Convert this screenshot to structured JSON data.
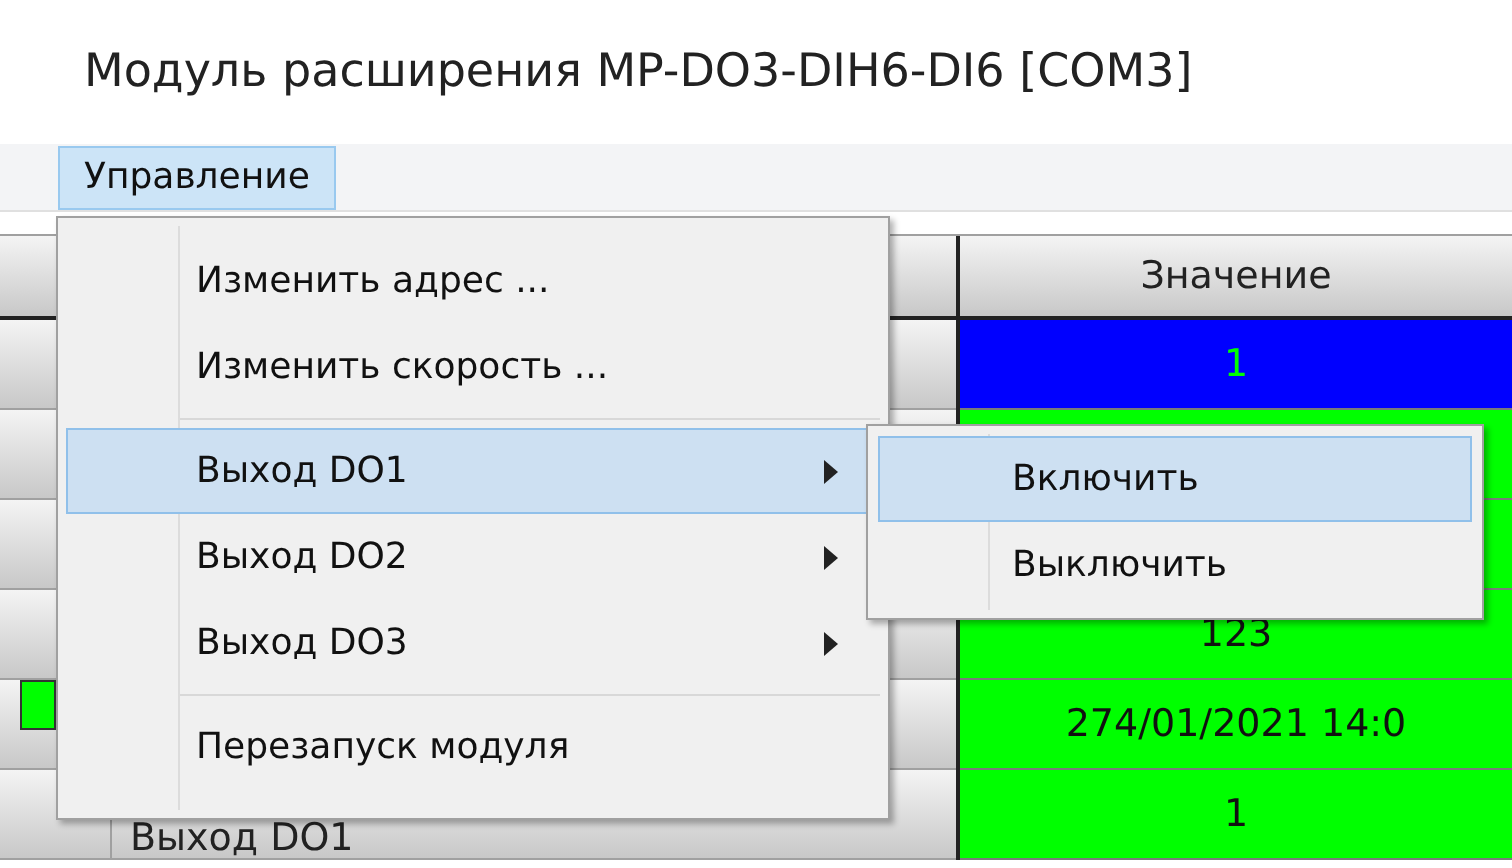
{
  "window": {
    "title": "Модуль расширения MP-DO3-DIH6-DI6 [COM3]"
  },
  "menu_bar": [
    {
      "label": "Управление",
      "selected": true
    }
  ],
  "table": {
    "columns": [
      {
        "label": "Значение"
      }
    ],
    "rows": [
      {
        "value": "1",
        "color": "#0000ff",
        "indicator": false
      },
      {
        "color": "#00ff00",
        "indicator": false
      },
      {
        "color": "#00ff00",
        "indicator": false
      },
      {
        "value": "123",
        "color": "#00ff00",
        "indicator": false
      },
      {
        "value": "274/01/2021  14:0",
        "color": "#00ff00",
        "indicator": true
      },
      {
        "name": "Выход DO1",
        "value": "1",
        "color": "#00ff00",
        "indicator": false
      }
    ]
  },
  "dropdown": {
    "items": [
      {
        "kind": "item",
        "label": "Изменить адрес ...",
        "submenu": false,
        "selected": false
      },
      {
        "kind": "item",
        "label": "Изменить скорость ...",
        "submenu": false,
        "selected": false
      },
      {
        "kind": "separator"
      },
      {
        "kind": "item",
        "label": "Выход DO1",
        "submenu": true,
        "selected": true
      },
      {
        "kind": "item",
        "label": "Выход DO2",
        "submenu": true,
        "selected": false
      },
      {
        "kind": "item",
        "label": "Выход DO3",
        "submenu": true,
        "selected": false
      },
      {
        "kind": "separator"
      },
      {
        "kind": "item",
        "label": "Перезапуск модуля",
        "submenu": false,
        "selected": false
      }
    ]
  },
  "submenu": {
    "items": [
      {
        "label": "Включить",
        "selected": true
      },
      {
        "label": "Выключить",
        "selected": false
      }
    ]
  }
}
